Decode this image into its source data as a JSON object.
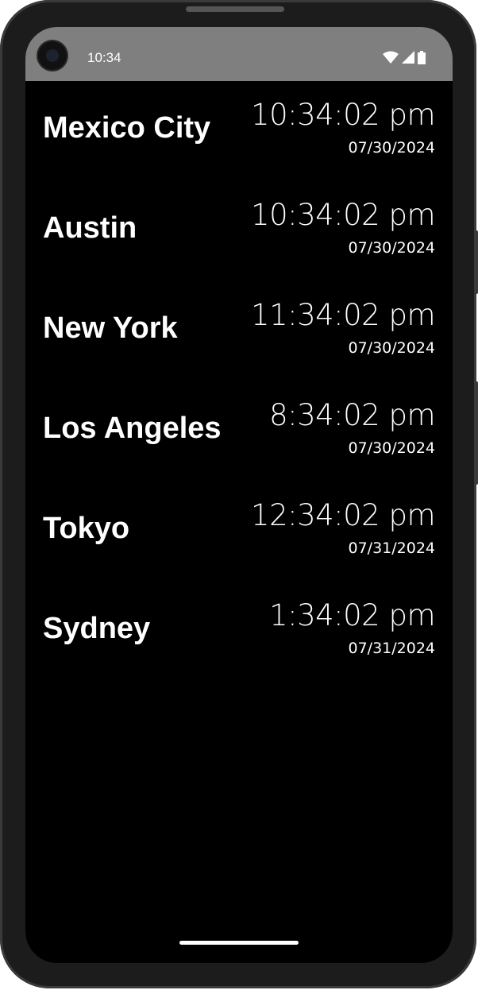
{
  "status_bar": {
    "time": "10:34",
    "icons": [
      "wifi-icon",
      "signal-icon",
      "battery-icon"
    ]
  },
  "clocks": [
    {
      "city": "Mexico City",
      "time": "10:34:02 pm",
      "date": "07/30/2024"
    },
    {
      "city": "Austin",
      "time": "10:34:02 pm",
      "date": "07/30/2024"
    },
    {
      "city": "New York",
      "time": "11:34:02 pm",
      "date": "07/30/2024"
    },
    {
      "city": "Los Angeles",
      "time": "8:34:02 pm",
      "date": "07/30/2024"
    },
    {
      "city": "Tokyo",
      "time": "12:34:02 pm",
      "date": "07/31/2024"
    },
    {
      "city": "Sydney",
      "time": "1:34:02 pm",
      "date": "07/31/2024"
    }
  ],
  "colors": {
    "background": "#000000",
    "status_bar": "#7f7f7f",
    "text": "#ffffff"
  }
}
